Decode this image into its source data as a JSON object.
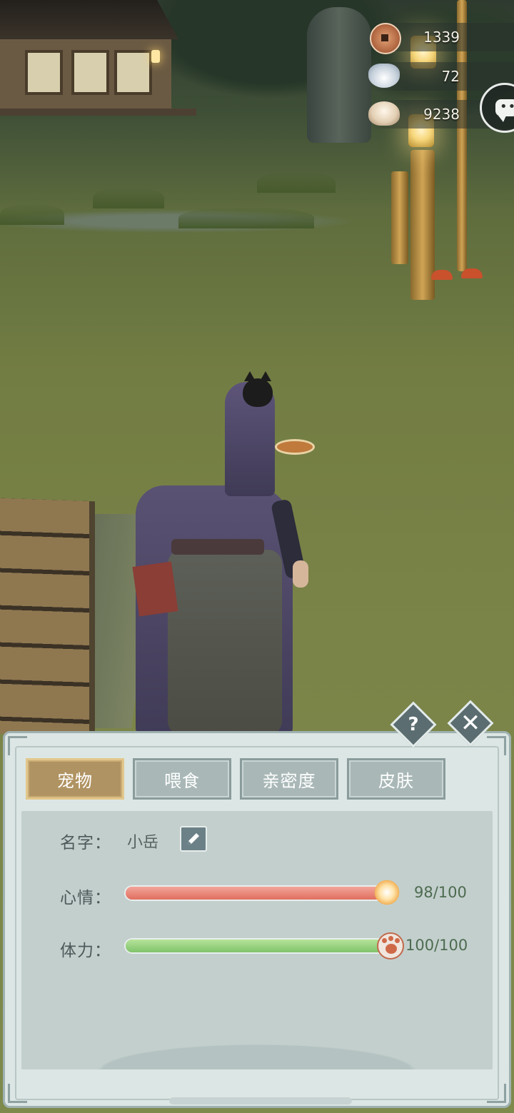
{
  "hud": {
    "copper_coins": "1339",
    "silver_ingots": "72",
    "shells": "9238",
    "icons": [
      "coin-icon",
      "silver-ingot-icon",
      "shell-icon",
      "chat-icon"
    ]
  },
  "panel": {
    "help_label": "?",
    "close_label": "✕",
    "tabs": [
      {
        "label": "宠物",
        "active": true
      },
      {
        "label": "喂食",
        "active": false
      },
      {
        "label": "亲密度",
        "active": false
      },
      {
        "label": "皮肤",
        "active": false
      }
    ],
    "name_label": "名字：",
    "name_value": "小岳",
    "mood_label": "心情：",
    "mood_value": "98/100",
    "mood_fraction": 0.98,
    "stamina_label": "体力：",
    "stamina_value": "100/100",
    "stamina_fraction": 1.0
  },
  "colors": {
    "tab_active": "#b09362",
    "tab_inactive": "#a9b8b7",
    "mood_bar": "#e06f5f",
    "stamina_bar": "#7fc36a",
    "panel_bg": "#dce6e4"
  }
}
